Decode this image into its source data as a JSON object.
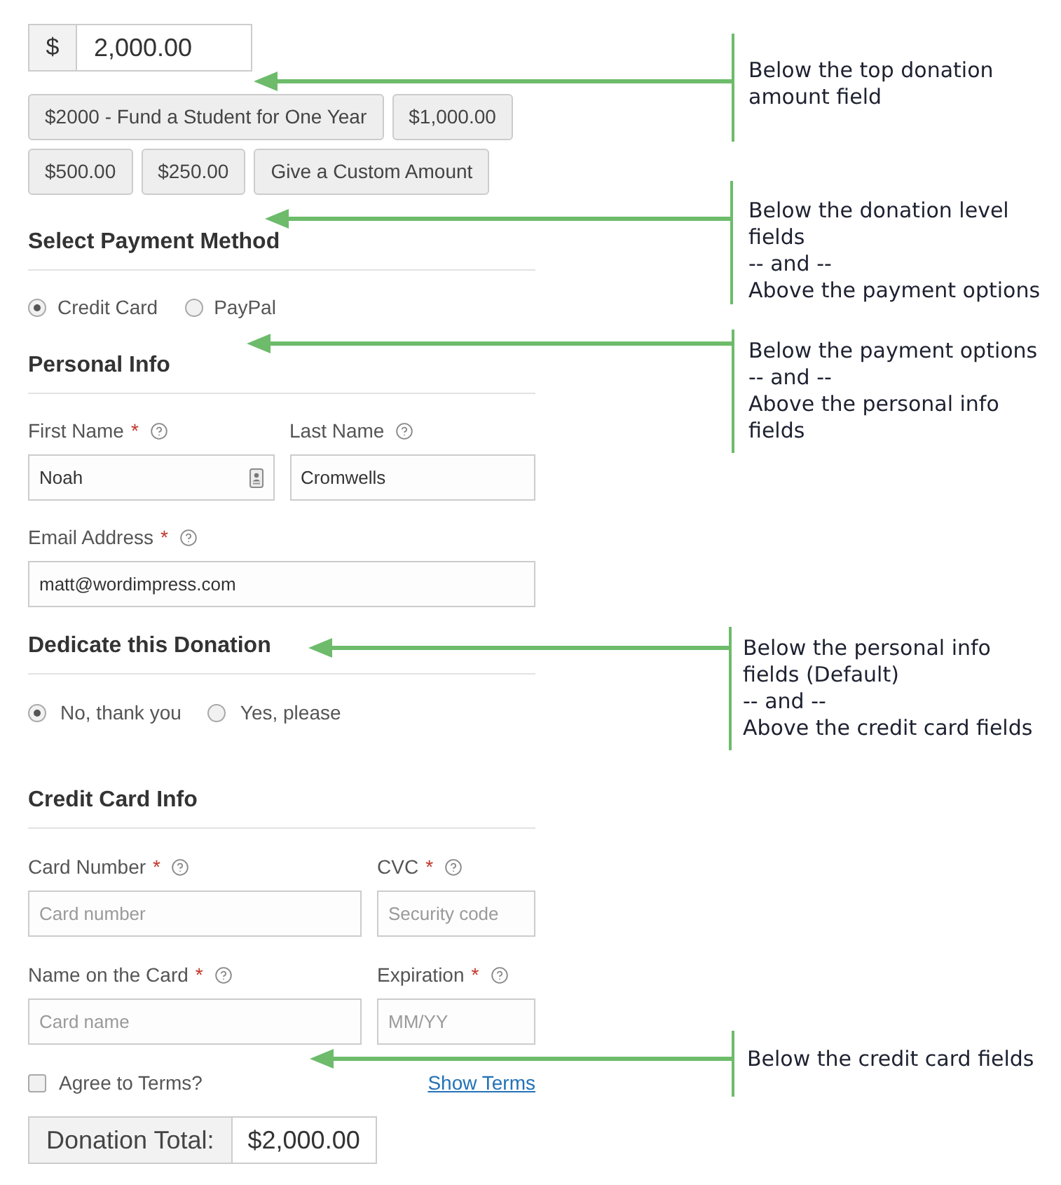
{
  "donation_amount": {
    "currency": "$",
    "value": "2,000.00"
  },
  "donation_levels": [
    {
      "label": "$2000 - Fund a Student for One Year"
    },
    {
      "label": "$1,000.00"
    },
    {
      "label": "$500.00"
    },
    {
      "label": "$250.00"
    },
    {
      "label": "Give a Custom Amount"
    }
  ],
  "payment_method": {
    "heading": "Select Payment Method",
    "options": [
      {
        "label": "Credit Card",
        "selected": true
      },
      {
        "label": "PayPal",
        "selected": false
      }
    ]
  },
  "personal_info": {
    "heading": "Personal Info",
    "fields": [
      {
        "label": "First Name",
        "required_mark": "*",
        "help_icon": true,
        "value": "Noah",
        "autofill_icon": true
      },
      {
        "label": "Last Name",
        "help_icon": true,
        "value": "Cromwells"
      },
      {
        "label": "Email Address",
        "required_mark": "*",
        "help_icon": true,
        "value": "matt@wordimpress.com"
      }
    ]
  },
  "dedicate": {
    "heading": "Dedicate this Donation",
    "options": [
      {
        "label": "No, thank you",
        "selected": true
      },
      {
        "label": "Yes, please",
        "selected": false
      }
    ]
  },
  "credit_card": {
    "heading": "Credit Card Info",
    "fields": [
      {
        "label": "Card Number",
        "required_mark": "*",
        "help_icon": true,
        "placeholder": "Card number"
      },
      {
        "label": "CVC",
        "required_mark": "*",
        "help_icon": true,
        "placeholder": "Security code"
      },
      {
        "label": "Name on the Card",
        "required_mark": "*",
        "help_icon": true,
        "placeholder": "Card name"
      },
      {
        "label": "Expiration",
        "required_mark": "*",
        "help_icon": true,
        "placeholder": "MM/YY"
      }
    ]
  },
  "terms": {
    "label": "Agree to Terms?",
    "checked": false,
    "link": "Show Terms"
  },
  "total": {
    "label": "Donation Total:",
    "value": "$2,000.00"
  },
  "annotations": [
    {
      "lines": [
        "Below the top donation",
        "amount field"
      ]
    },
    {
      "lines": [
        "Below the donation level",
        "fields",
        "-- and --",
        "Above the payment options"
      ]
    },
    {
      "lines": [
        "Below the payment options",
        "-- and --",
        "Above the personal info",
        "fields"
      ]
    },
    {
      "lines": [
        "Below the personal info",
        "fields (Default)",
        "-- and --",
        "Above the credit card fields"
      ]
    },
    {
      "lines": [
        "Below the credit card fields"
      ]
    }
  ]
}
